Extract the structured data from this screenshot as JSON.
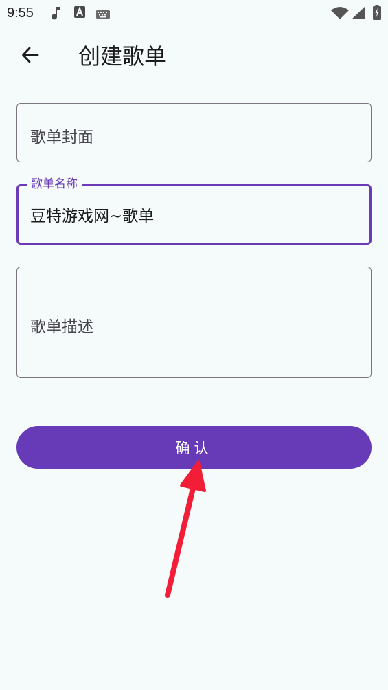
{
  "status_bar": {
    "time": "9:55",
    "icons": [
      "music-note-icon",
      "text-a-icon",
      "keyboard-icon",
      "wifi-icon",
      "signal-icon",
      "battery-icon"
    ]
  },
  "app_bar": {
    "title": "创建歌单",
    "back_icon": "arrow-left-icon"
  },
  "form": {
    "cover_placeholder": "歌单封面",
    "name_label": "歌单名称",
    "name_value": "豆特游戏网~歌单",
    "description_placeholder": "歌单描述"
  },
  "actions": {
    "confirm_label": "确认"
  },
  "colors": {
    "accent": "#673ab7",
    "background": "#f4fbfa",
    "outline": "#79747e",
    "annotation_arrow": "#f21d37"
  }
}
